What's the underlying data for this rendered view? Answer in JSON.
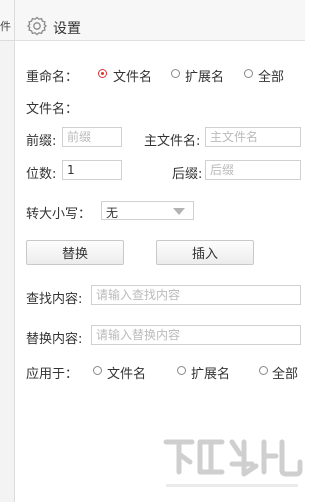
{
  "sidebar": {
    "glyph": "件"
  },
  "header": {
    "title": "设置",
    "icon": "gear-icon"
  },
  "rename": {
    "label": "重命名：",
    "options": [
      "文件名",
      "扩展名",
      "全部"
    ],
    "selected": "文件名"
  },
  "filename": {
    "section_label": "文件名：",
    "prefix_label": "前缀:",
    "prefix_placeholder": "前缀",
    "main_label": "主文件名:",
    "main_placeholder": "主文件名",
    "digits_label": "位数:",
    "digits_value": "1",
    "suffix_label": "后缀:",
    "suffix_placeholder": "后缀"
  },
  "case": {
    "label": "转大小写：",
    "selected": "无"
  },
  "buttons": {
    "replace": "替换",
    "insert": "插入"
  },
  "find": {
    "label": "查找内容:",
    "placeholder": "请输入查找内容"
  },
  "replace_with": {
    "label": "替换内容:",
    "placeholder": "请输入替换内容"
  },
  "apply": {
    "label": "应用于：",
    "options": [
      "文件名",
      "扩展名",
      "全部"
    ]
  },
  "colors": {
    "accent": "#dd3333",
    "header_bg": "#f7f7f7"
  }
}
